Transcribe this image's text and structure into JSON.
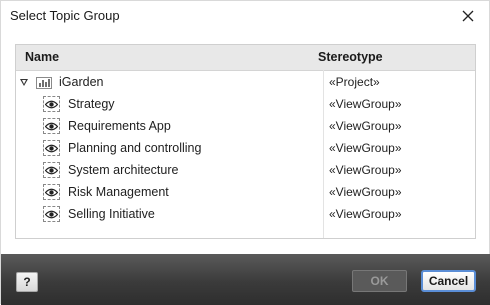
{
  "dialog": {
    "title": "Select Topic Group",
    "close_icon": "close-x-icon"
  },
  "tree": {
    "columns": {
      "name": "Name",
      "stereotype": "Stereotype"
    },
    "root": {
      "label": "iGarden",
      "stereotype": "«Project»",
      "icon": "project-chart-icon",
      "expanded": true
    },
    "children": [
      {
        "label": "Strategy",
        "stereotype": "«ViewGroup»",
        "icon": "eye-icon"
      },
      {
        "label": "Requirements App",
        "stereotype": "«ViewGroup»",
        "icon": "eye-icon"
      },
      {
        "label": "Planning and controlling",
        "stereotype": "«ViewGroup»",
        "icon": "eye-icon"
      },
      {
        "label": "System architecture",
        "stereotype": "«ViewGroup»",
        "icon": "eye-icon"
      },
      {
        "label": "Risk Management",
        "stereotype": "«ViewGroup»",
        "icon": "eye-icon"
      },
      {
        "label": "Selling Initiative",
        "stereotype": "«ViewGroup»",
        "icon": "eye-icon"
      }
    ]
  },
  "footer": {
    "help_label": "?",
    "ok_label": "OK",
    "cancel_label": "Cancel"
  },
  "colors": {
    "accent": "#5b8ed6",
    "footer_bg": "#3b3b3b",
    "header_bg": "#e8e8e8"
  }
}
